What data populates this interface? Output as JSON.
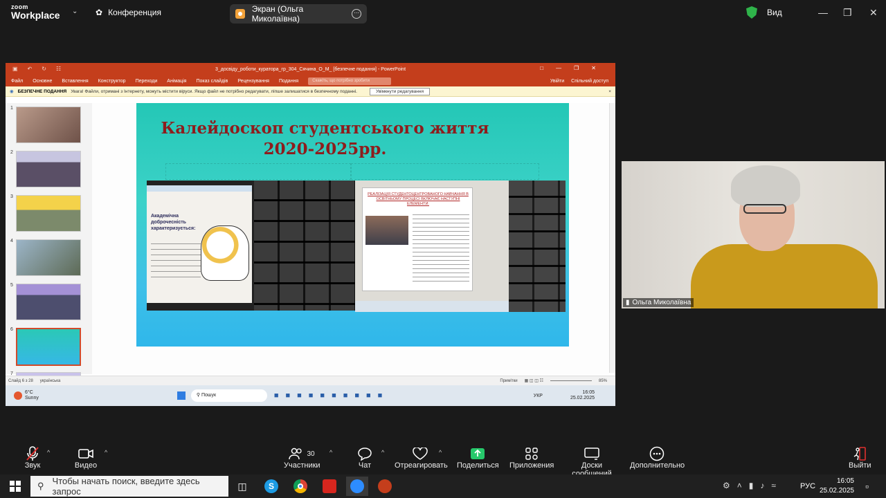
{
  "zoom": {
    "logo_line1": "zoom",
    "logo_line2": "Workplace",
    "meeting_label": "Конференция",
    "share_pill": "Экран (Ольга Миколаївна)",
    "view_label": "Вид",
    "participant_name": "Ольга Миколаївна",
    "toolbar": {
      "audio": "Звук",
      "video": "Видео",
      "participants": "Участники",
      "participants_count": "30",
      "chat": "Чат",
      "reactions": "Отреагировать",
      "share": "Поделиться",
      "apps": "Приложения",
      "whiteboards": "Доски сообщений",
      "more": "Дополнительно",
      "leave": "Выйти"
    }
  },
  "ppt": {
    "title": "3_досвіду_роботи_куратора_гр_304_Сячина_О_М_ [безпечне подання] - PowerPoint",
    "menu": [
      "Файл",
      "Основне",
      "Вставлення",
      "Конструктор",
      "Переходи",
      "Анімація",
      "Показ слайдів",
      "Рецензування",
      "Подання"
    ],
    "search_placeholder": "Скажіть, що потрібно зробити",
    "sign_in": "Увійти",
    "share": "Спільний доступ",
    "protected_label": "БЕЗПЕЧНЕ ПОДАННЯ",
    "protected_text": "Увага! Файли, отримані з Інтернету, можуть містити віруси. Якщо файл не потрібно редагувати, ліпше залишатися в безпечному поданні.",
    "enable_edit": "Увімкнути редагування",
    "slide_numbers": [
      "1",
      "2",
      "3",
      "4",
      "5",
      "6",
      "7"
    ],
    "slide_title_line1": "Калейдоскоп студентського життя",
    "slide_title_line2": "2020-2025рр.",
    "left_shot_heading": "Академічна доброчесність характеризується:",
    "right_shot_heading": "РЕАЛІЗАЦІЯ СТУДЕНТОЦЕНТРОВАНОГО НАВЧАННЯ В ОСВІТНЬОМУ ПРОЦЕСІ ВКЛЮЧАЄ НАСТУПНІ ЕЛЕМЕНТИ:",
    "status_slide": "Слайд 6 з 28",
    "status_lang": "українська",
    "status_notes": "Примітки",
    "zoom_pct": "85%",
    "inner_weather_temp": "6°C",
    "inner_weather_desc": "Sunny",
    "inner_search": "Пошук",
    "inner_lang": "УКР",
    "inner_time": "16:05",
    "inner_date": "25.02.2025"
  },
  "windows": {
    "search_placeholder": "Чтобы начать поиск, введите здесь запрос",
    "lang": "РУС",
    "time": "16:05",
    "date": "25.02.2025"
  }
}
